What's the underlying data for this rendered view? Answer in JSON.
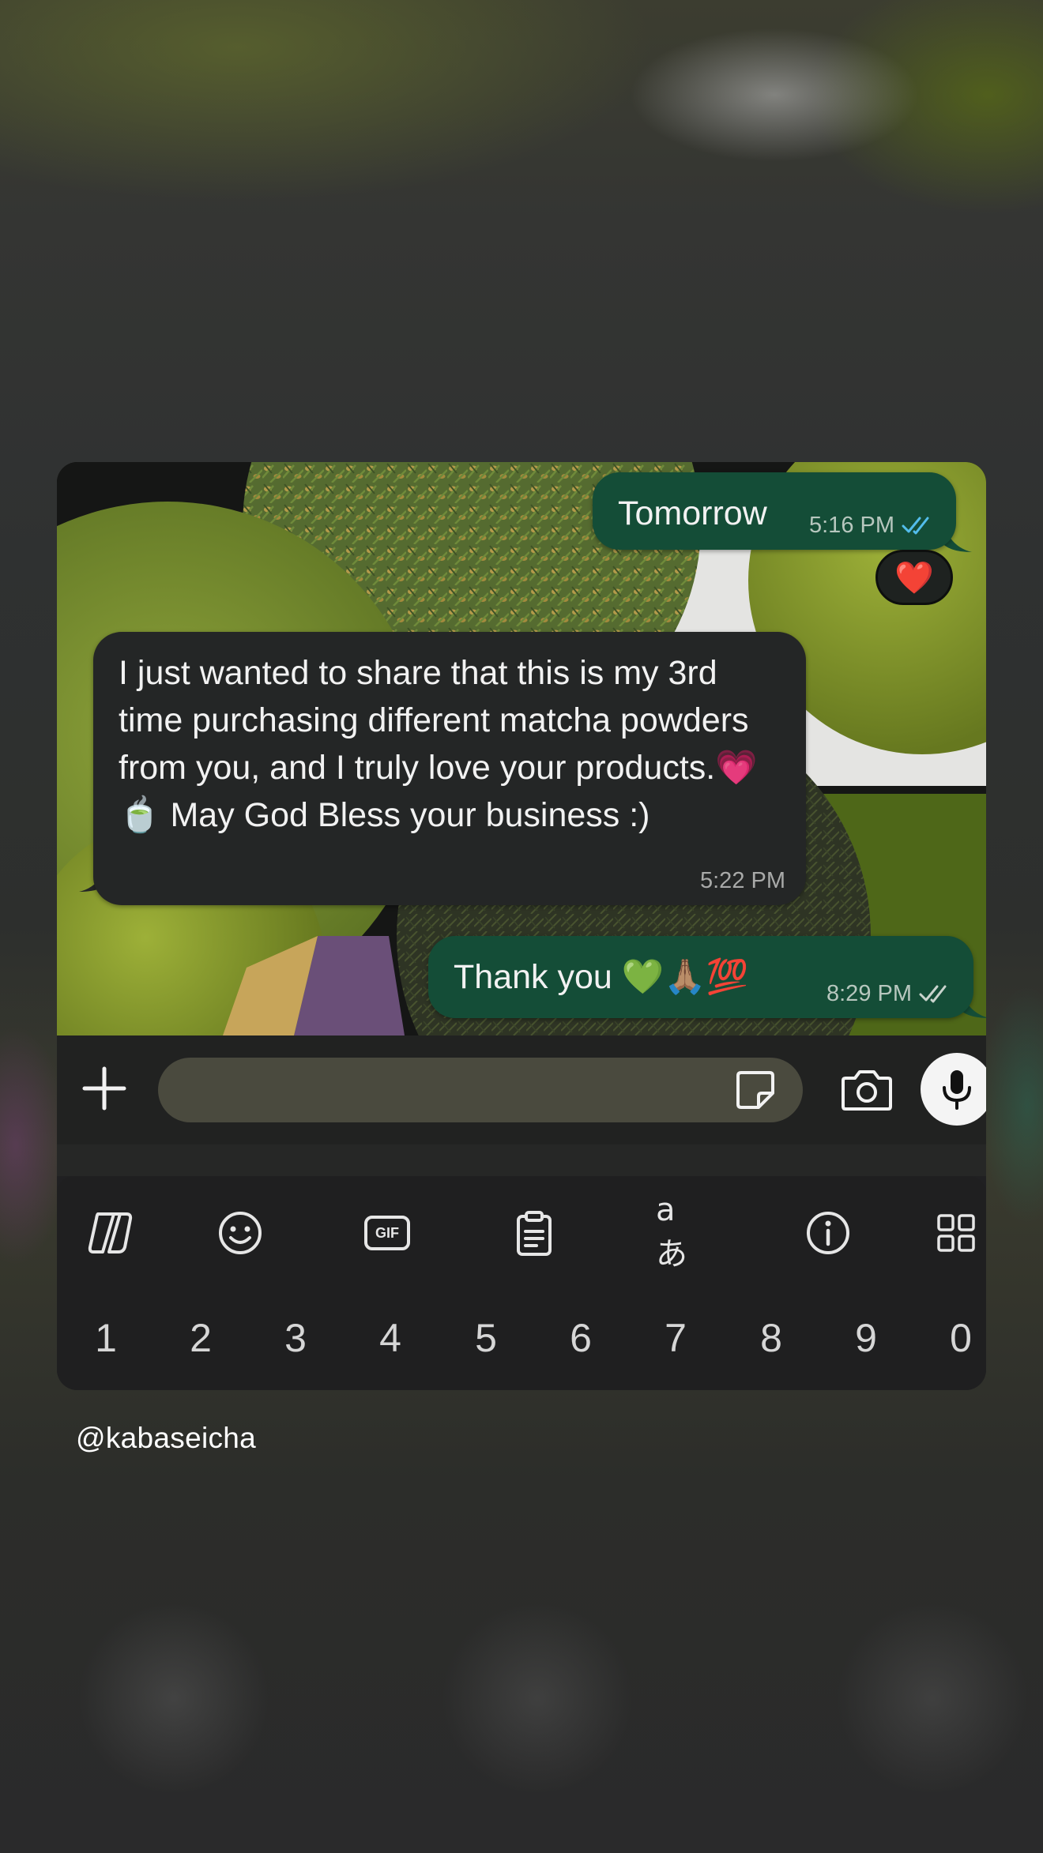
{
  "colors": {
    "outgoing_bubble": "#144d37",
    "incoming_bubble": "#242626",
    "read_tick": "#53bdeb",
    "input_field": "#4a4a3e",
    "keyboard": "#1f1f20"
  },
  "messages": [
    {
      "direction": "out",
      "text": "Tomorrow",
      "time": "5:16 PM",
      "status": "read",
      "reaction": "❤️"
    },
    {
      "direction": "in",
      "text": "I just wanted to share that this is my 3rd time purchasing different matcha powders from you, and I truly love your products.💗🍵 May God Bless your business :)",
      "time": "5:22 PM"
    },
    {
      "direction": "out",
      "text": "Thank you 💚🙏🏽💯",
      "time": "8:29 PM",
      "status": "delivered"
    }
  ],
  "input_bar": {
    "add_icon": "plus-icon",
    "placeholder": "",
    "sticker_icon": "sticker-icon",
    "camera_icon": "camera-icon",
    "mic_icon": "microphone-icon"
  },
  "keyboard": {
    "toolbar": [
      "copilot-icon",
      "emoji-icon",
      "gif-icon",
      "clipboard-icon",
      "translate-icon",
      "info-icon",
      "apps-grid-icon"
    ],
    "gif_label": "GIF",
    "translate_label": "aあ",
    "number_keys": [
      "1",
      "2",
      "3",
      "4",
      "5",
      "6",
      "7",
      "8",
      "9",
      "0"
    ]
  },
  "watermark": "@kabaseicha"
}
